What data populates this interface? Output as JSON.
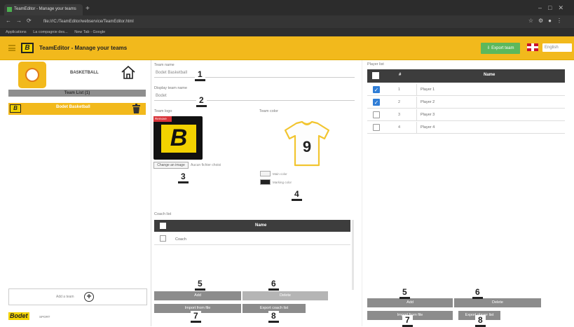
{
  "browser": {
    "tab_title": "TeamEditor - Manage your teams",
    "url": "file:///C:/TeamEditor/webservice/TeamEditor.html",
    "bookmarks": [
      "Applications",
      "La compagnie des...",
      "New Tab - Google"
    ]
  },
  "header": {
    "title": "TeamEditor - Manage your teams",
    "export_label": "Export team",
    "language": "English"
  },
  "sidebar": {
    "sport": "BASKETBALL",
    "team_list_header": "Team List (1)",
    "team_name": "Bodet Basketball",
    "add_team_label": "Add a team",
    "brand": "Bodet",
    "brand_sub": "SPORT"
  },
  "team_form": {
    "team_name_label": "Team name",
    "team_name_value": "Bodet Basketball",
    "display_name_label": "Display team name",
    "display_name_value": "Bodet",
    "logo_label": "Team logo",
    "logo_letter": "B",
    "logo_badge": "Remove",
    "color_label": "Team color",
    "change_logo_label": "Change an image",
    "no_file_label": "Aucun fichier choisi",
    "jersey_number": "9",
    "main_color_label": "Main color",
    "number_color_label": "Marking color",
    "colors": {
      "main": "#f3f3f3",
      "marking": "#222222"
    }
  },
  "coach": {
    "list_label": "Coach list",
    "header_name": "Name",
    "rows": [
      "Coach"
    ],
    "add_label": "Add",
    "delete_label": "Delete",
    "import_label": "Import from file",
    "export_label": "Export coach list"
  },
  "players": {
    "list_label": "Player list",
    "header_num": "#",
    "header_name": "Name",
    "rows": [
      {
        "num": "1",
        "name": "Player 1",
        "checked": true
      },
      {
        "num": "2",
        "name": "Player 2",
        "checked": true
      },
      {
        "num": "3",
        "name": "Player 3",
        "checked": false
      },
      {
        "num": "4",
        "name": "Player 4",
        "checked": false
      }
    ],
    "add_label": "Add",
    "delete_label": "Delete",
    "import_label": "Import from file",
    "export_label": "Export player list"
  },
  "callouts": [
    "1",
    "2",
    "3",
    "4",
    "5",
    "6",
    "7",
    "8",
    "5",
    "6",
    "7",
    "8"
  ],
  "accent_color": "#f2b91c"
}
